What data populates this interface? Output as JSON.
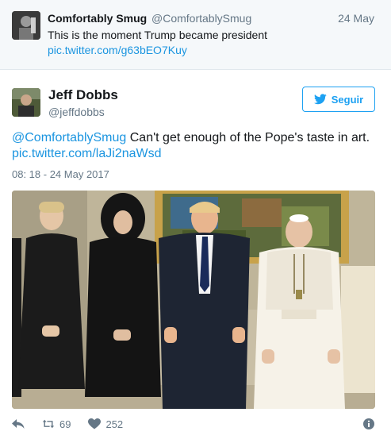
{
  "parent_tweet": {
    "name": "Comfortably Smug",
    "handle": "@ComfortablySmug",
    "date": "24 May",
    "text": "This is the moment Trump became president",
    "link": "pic.twitter.com/g63bEO7Kuy"
  },
  "main_tweet": {
    "name": "Jeff Dobbs",
    "handle": "@jeffdobbs",
    "follow_label": "Seguir",
    "mention": "@ComfortablySmug",
    "text": " Can't get enough of the Pope's taste in art.",
    "link": "pic.twitter.com/laJi2naWsd",
    "timestamp": "08: 18 - 24 May 2017"
  },
  "actions": {
    "retweets": "69",
    "likes": "252"
  },
  "colors": {
    "link": "#1b95e0",
    "accent": "#1da1f2",
    "muted": "#657786"
  }
}
